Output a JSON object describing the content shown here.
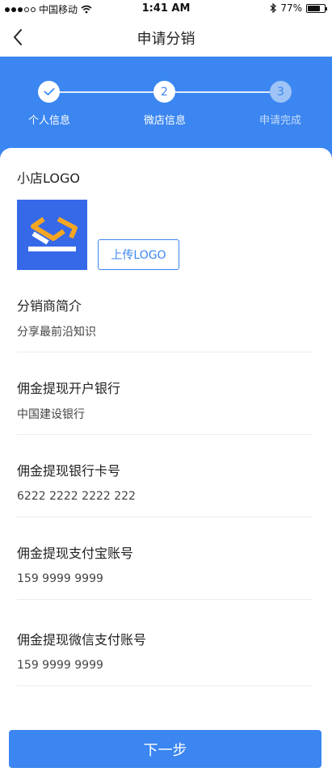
{
  "status_bar": {
    "carrier": "中国移动",
    "time": "1:41 AM",
    "battery": "77%",
    "battery_level": 0.77,
    "icons": [
      "signal-dots-icon",
      "wifi-icon",
      "bluetooth-icon",
      "battery-icon"
    ]
  },
  "nav": {
    "title": "申请分销",
    "back_icon": "chevron-left-icon"
  },
  "steps": [
    {
      "label": "个人信息",
      "marker": "",
      "state": "done"
    },
    {
      "label": "微店信息",
      "marker": "2",
      "state": "current"
    },
    {
      "label": "申请完成",
      "marker": "3",
      "state": "pending"
    }
  ],
  "logo_section": {
    "title": "小店LOGO",
    "upload_label": "上传LOGO"
  },
  "fields": [
    {
      "label": "分销商简介",
      "value": "分享最前沿知识"
    },
    {
      "label": "佣金提现开户银行",
      "value": "中国建设银行"
    },
    {
      "label": "佣金提现银行卡号",
      "value": "6222 2222 2222 222"
    },
    {
      "label": "佣金提现支付宝账号",
      "value": "159 9999 9999"
    },
    {
      "label": "佣金提现微信支付账号",
      "value": "159 9999 9999"
    }
  ],
  "next_button": "下一步",
  "colors": {
    "primary": "#3b86f0",
    "logo_bg": "#3669e8",
    "logo_accent": "#f5a623"
  }
}
